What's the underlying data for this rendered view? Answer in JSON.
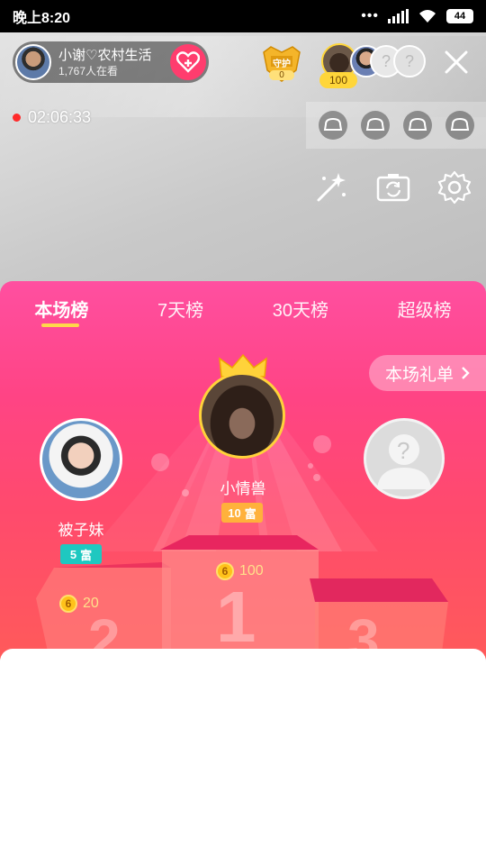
{
  "status_bar": {
    "time": "晚上8:20",
    "dots": "•••",
    "battery": "44"
  },
  "host": {
    "name": "小谢♡农村生活",
    "viewers": "1,767人在看"
  },
  "guard": {
    "label": "守护",
    "count": "0"
  },
  "top_viewers": {
    "score": "100"
  },
  "live": {
    "timer": "02:06:33"
  },
  "ranking": {
    "tabs": [
      "本场榜",
      "7天榜",
      "30天榜",
      "超级榜"
    ],
    "gift_list_label": "本场礼单",
    "first": {
      "name": "小情兽",
      "badge_level": "10",
      "badge_suffix": "富",
      "coins": "100",
      "rank": "1"
    },
    "second": {
      "name": "被子妹",
      "badge_level": "5",
      "badge_suffix": "富",
      "coins": "20",
      "rank": "2"
    },
    "third": {
      "rank": "3"
    },
    "coin_symbol": "6"
  },
  "colors": {
    "accent_pink": "#ff4485",
    "gold": "#ffd84a",
    "teal_badge": "#1fc8c0",
    "orange_badge": "#ffb13b"
  }
}
